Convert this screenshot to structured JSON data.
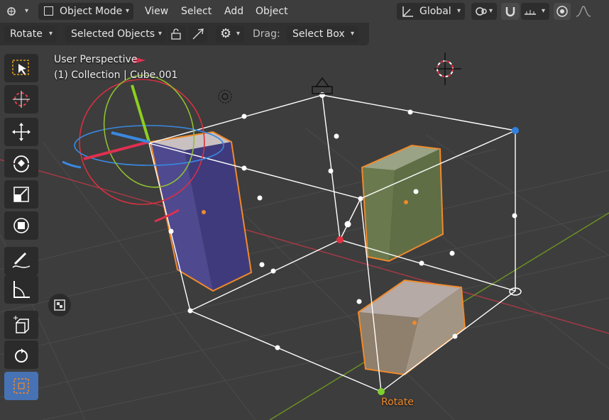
{
  "header": {
    "mode": "Object Mode",
    "menus": [
      "View",
      "Select",
      "Add",
      "Object"
    ],
    "orientation": "Global"
  },
  "tool_settings": {
    "transform_tool": "Rotate",
    "pivot": "Selected Objects",
    "drag_label": "Drag:",
    "drag_value": "Select Box"
  },
  "viewport": {
    "perspective": "User Perspective",
    "collection_info": "(1) Collection | Cube.001",
    "gizmo_label": "Rotate"
  },
  "toolbar": {
    "tools": [
      "select-box",
      "cursor",
      "move",
      "rotate",
      "scale",
      "transform",
      "annotate",
      "measure",
      "add-cube",
      "rotate-transform",
      "scale-cage"
    ],
    "active_tool": "scale-cage"
  },
  "colors": {
    "background": "#3d3d3d",
    "grid": "#4a4a4a",
    "x_axis": "#a33a45",
    "y_axis": "#6b8f23",
    "accent": "#4772b3",
    "selection_outline": "#f08a2b",
    "cage_active_handle": "#e03040"
  }
}
